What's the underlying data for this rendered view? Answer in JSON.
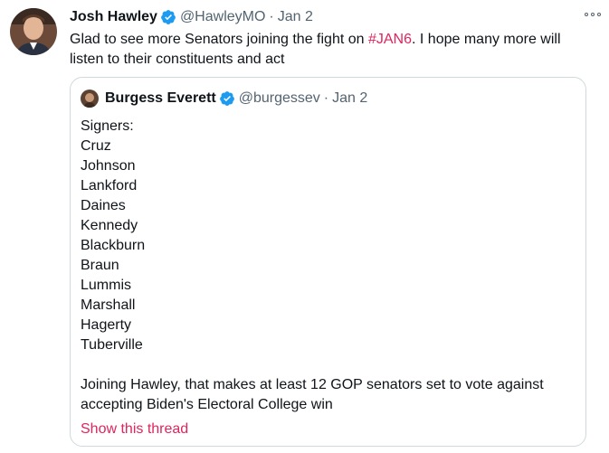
{
  "tweet": {
    "author_name": "Josh Hawley",
    "handle": "@HawleyMO",
    "separator": "·",
    "date": "Jan 2",
    "text_before": "Glad to see more Senators joining the fight on ",
    "hashtag": "#JAN6",
    "text_after": ". I hope many more will listen to their constituents and act",
    "more_icon": "more-dots-icon",
    "verified_icon": "verified-badge-icon",
    "verified_color": "#1d9bf0",
    "link_color": "#e0245e"
  },
  "quote": {
    "author_name": "Burgess Everett",
    "handle": "@burgessev",
    "separator": "·",
    "date": "Jan 2",
    "lines": [
      "Signers:",
      "Cruz",
      "Johnson",
      "Lankford",
      "Daines",
      "Kennedy",
      "Blackburn",
      "Braun",
      "Lummis",
      "Marshall",
      "Hagerty",
      "Tuberville"
    ],
    "summary_1": "Joining Hawley, that makes at least 12 GOP senators set to vote against",
    "summary_2": "accepting Biden's Electoral College win",
    "show_thread": "Show this thread"
  }
}
